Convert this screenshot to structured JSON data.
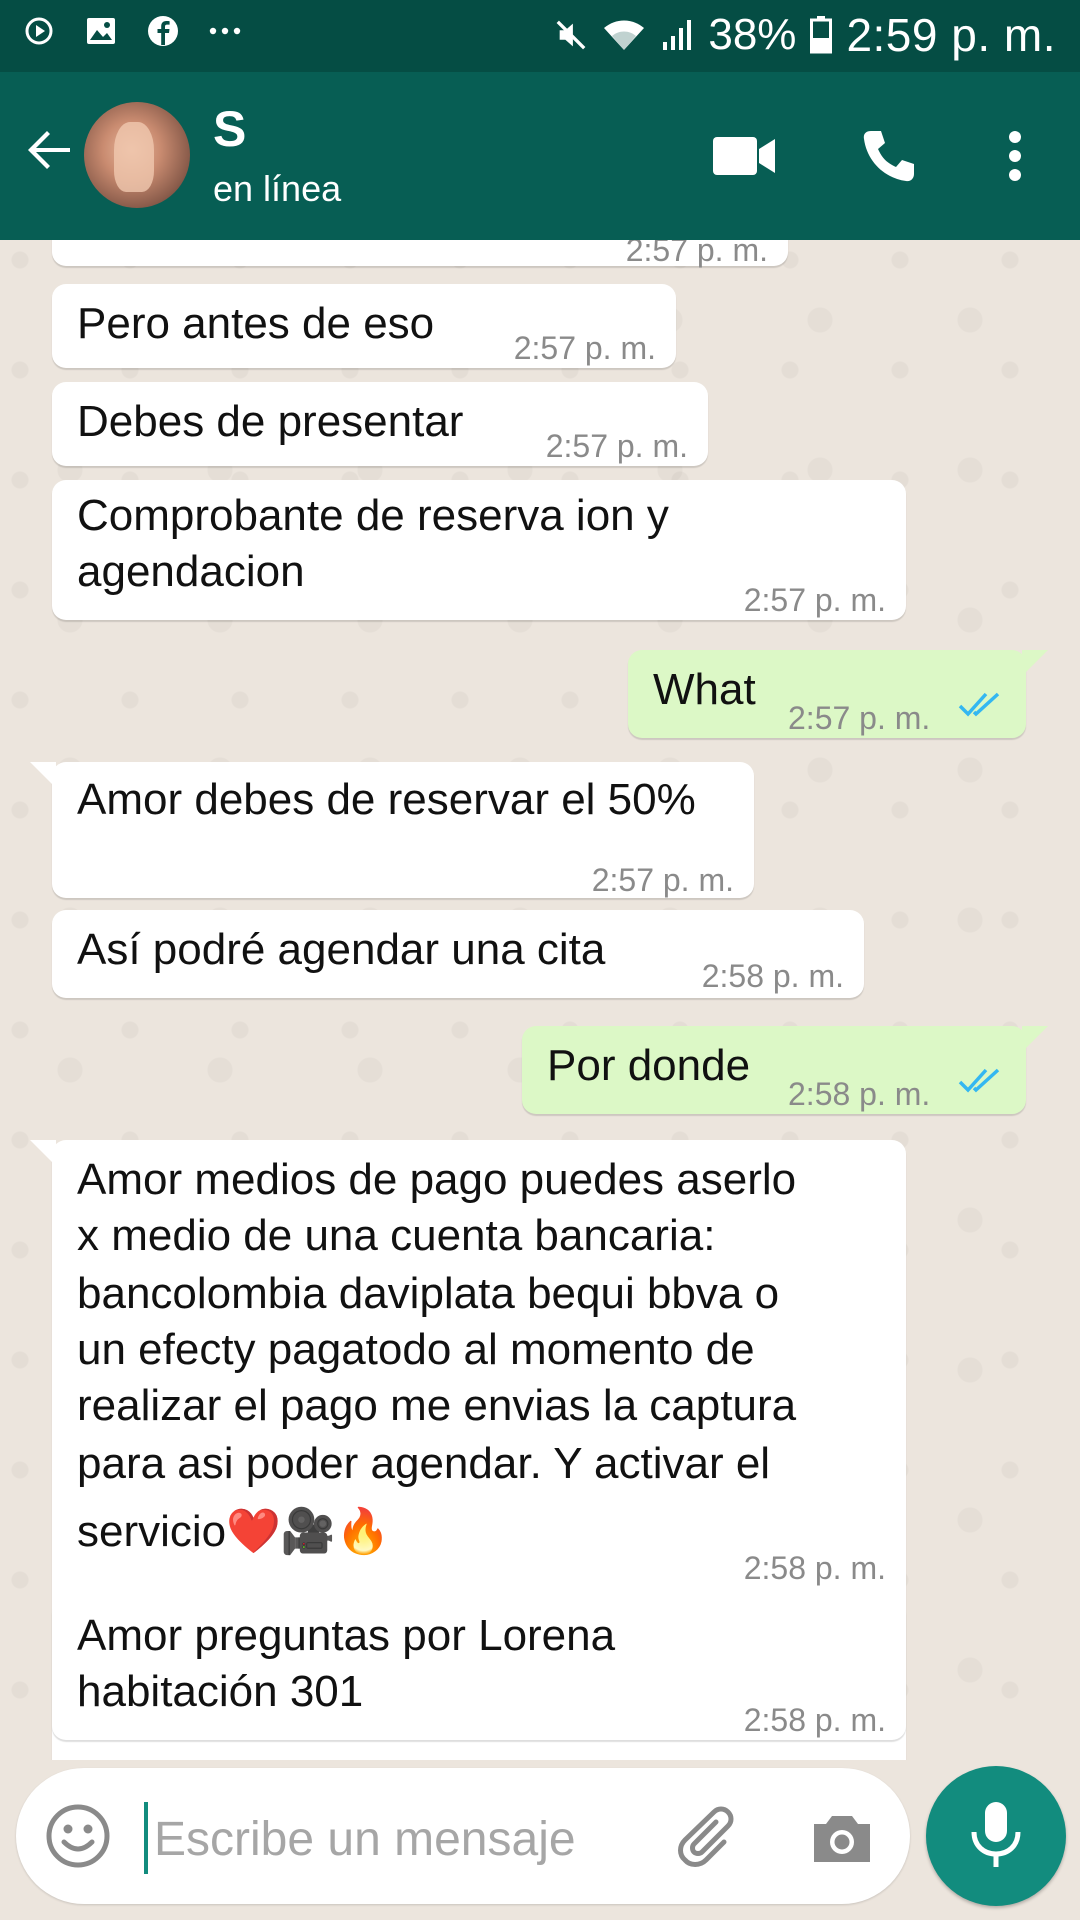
{
  "status_bar": {
    "battery": "38%",
    "time": "2:59 p. m.",
    "icons": [
      "play-icon",
      "image-icon",
      "facebook-icon",
      "more-notifications-icon",
      "mute-icon",
      "wifi-icon",
      "signal-icon",
      "battery-icon"
    ]
  },
  "header": {
    "contact_name": "S",
    "status": "en línea",
    "icons": [
      "back-arrow-icon",
      "video-call-icon",
      "phone-icon",
      "more-vert-icon"
    ]
  },
  "messages": [
    {
      "direction": "in",
      "text": "",
      "time": "2:57 p. m."
    },
    {
      "direction": "in",
      "text": "Pero antes de eso",
      "time": "2:57 p. m."
    },
    {
      "direction": "in",
      "text": "Debes de presentar",
      "time": "2:57 p. m."
    },
    {
      "direction": "in",
      "lines": [
        "Comprobante de reserva ion y",
        "agendacion"
      ],
      "time": "2:57 p. m."
    },
    {
      "direction": "out",
      "text": "What",
      "time": "2:57 p. m.",
      "read": true
    },
    {
      "direction": "in",
      "text": "Amor debes de reservar el 50%",
      "time": "2:57 p. m."
    },
    {
      "direction": "in",
      "text": "Así podré agendar una cita",
      "time": "2:58 p. m."
    },
    {
      "direction": "out",
      "text": "Por donde",
      "time": "2:58 p. m.",
      "read": true
    },
    {
      "direction": "in",
      "lines": [
        "Amor medios de pago puedes aserlo",
        "x medio de una cuenta bancaria:",
        "bancolombia daviplata bequi bbva o",
        "un efecty pagatodo al momento de",
        "realizar el pago me envias la captura",
        "para asi poder agendar. Y activar el",
        "servicio❤️🎥🔥"
      ],
      "time": "2:58 p. m."
    },
    {
      "direction": "in",
      "lines": [
        "Amor preguntas por Lorena",
        "habitación 301"
      ],
      "time": "2:58 p. m."
    }
  ],
  "composer": {
    "placeholder": "Escribe un mensaje",
    "icons": [
      "emoji-icon",
      "attach-icon",
      "camera-icon",
      "mic-icon"
    ]
  },
  "colors": {
    "status_bar": "#054D44",
    "app_bar": "#075E54",
    "outgoing_bubble": "#DCF8C6",
    "incoming_bubble": "#FFFFFF",
    "read_ticks": "#34B7F1",
    "mic_button": "#128C7E"
  }
}
